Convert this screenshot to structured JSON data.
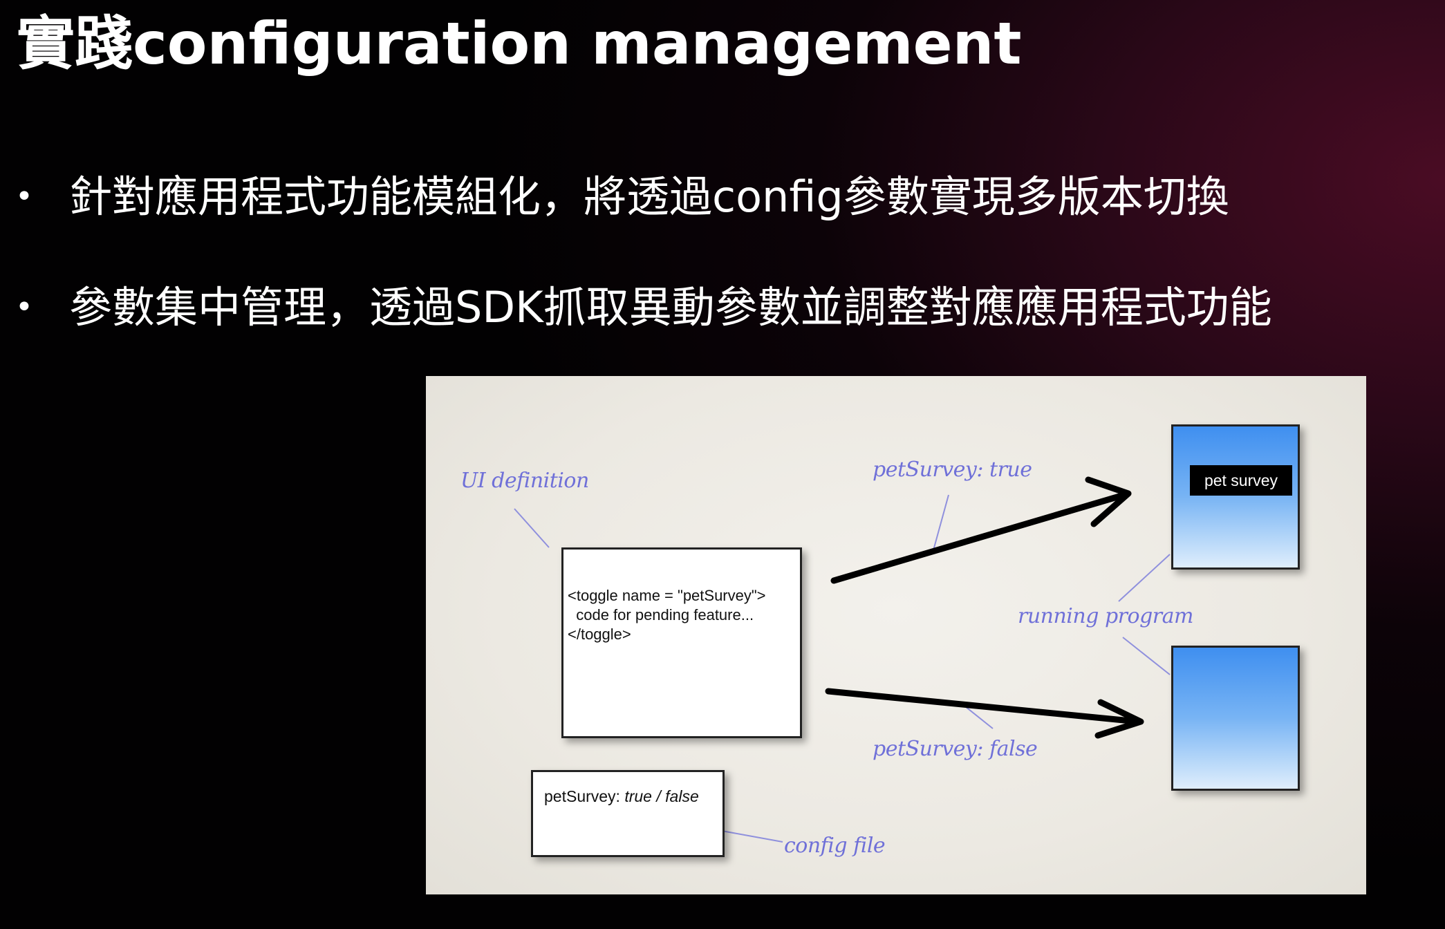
{
  "slide": {
    "title": "實踐configuration management",
    "bullets": [
      "針對應用程式功能模組化，將透過config參數實現多版本切換",
      "參數集中管理，透過SDK抓取異動參數並調整對應應用程式功能"
    ],
    "bullet_symbol": "•"
  },
  "diagram": {
    "ui_definition_label": "UI definition",
    "code_lines": [
      "<toggle name = \"petSurvey\">",
      "  code for pending feature...",
      "</toggle>"
    ],
    "config_key": "petSurvey: ",
    "config_value": "true / false",
    "config_file_label": "config file",
    "true_label": "petSurvey: true",
    "false_label": "petSurvey: false",
    "running_program_label": "running program",
    "pet_survey_button": "pet survey",
    "colors": {
      "annotation": "#6f70d8",
      "screen_top": "#3f8ff0",
      "screen_bottom": "#dfeefc",
      "arrow": "#000000"
    }
  }
}
